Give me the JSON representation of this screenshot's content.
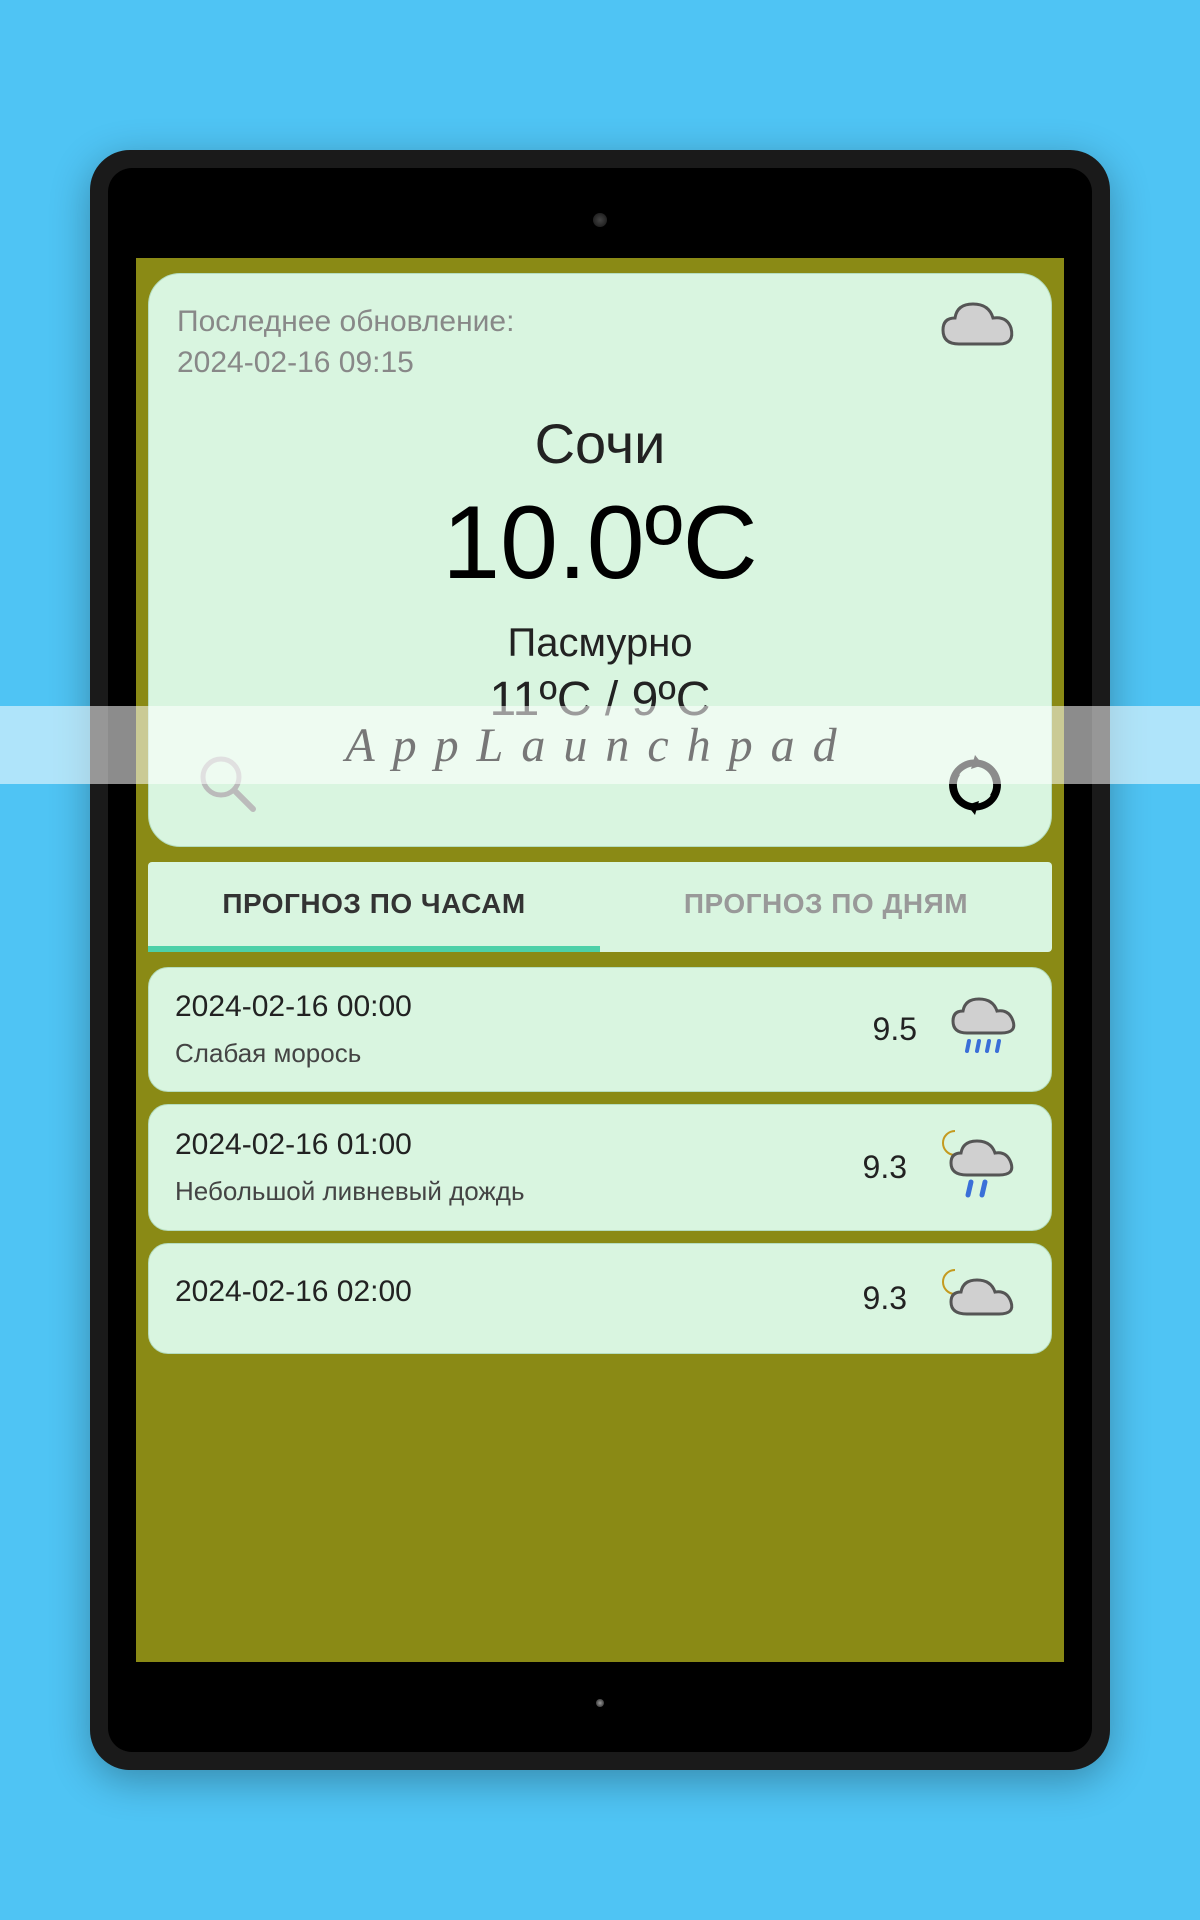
{
  "watermark": "AppLaunchpad",
  "header": {
    "update_label": "Последнее обновление:",
    "update_time": "2024-02-16 09:15",
    "city": "Сочи",
    "temperature": "10.0ºC",
    "condition": "Пасмурно",
    "minmax": "11ºC / 9ºC"
  },
  "tabs": {
    "hourly": "ПРОГНОЗ ПО ЧАСАМ",
    "daily": "ПРОГНОЗ ПО ДНЯМ"
  },
  "forecast": [
    {
      "datetime": "2024-02-16 00:00",
      "condition": "Слабая морось",
      "temp": "9.5",
      "icon": "cloud-drizzle"
    },
    {
      "datetime": "2024-02-16 01:00",
      "condition": "Небольшой ливневый дождь",
      "temp": "9.3",
      "icon": "moon-cloud-rain"
    },
    {
      "datetime": "2024-02-16 02:00",
      "condition": "",
      "temp": "9.3",
      "icon": "moon-cloud"
    }
  ]
}
